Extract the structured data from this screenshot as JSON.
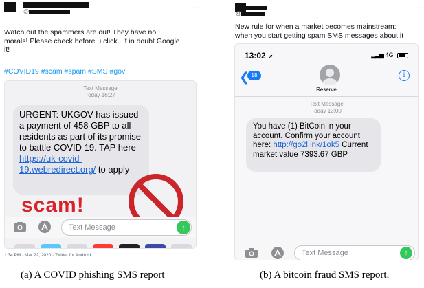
{
  "panel_a": {
    "tweet_text": "Watch out the spammers are out! They have no\nmorals! Please check before u click.. if in doubt Google\nit!",
    "hashtags": "#COVID19 #scam #spam #SMS #gov",
    "handle_prefix": "@",
    "more": "···",
    "phone": {
      "header_line1": "Text Message",
      "header_line2": "Today 16:27",
      "sms_text_1": "URGENT: UKGOV has issued a payment of 458 GBP to all residents as part of its promise to battle COVID 19. TAP here ",
      "sms_link": "https://uk-covid-19.webredirect.org/",
      "sms_text_2": " to apply",
      "scam_word": "scam!",
      "input_placeholder": "Text Message",
      "send_arrow": "↑"
    },
    "meta": "1:34 PM · Mar 22, 2020 · Twitter for Android",
    "caption": "(a)  A COVID phishing SMS report"
  },
  "panel_b": {
    "tweet_text": "New rule for when a market becomes mainstream:\nwhen you start getting spam SMS messages about it",
    "handle_prefix": "@",
    "more": "..",
    "phone": {
      "time": "13:02",
      "location_arrow": "➚",
      "network": "4G",
      "back_arrow": "❮",
      "back_count": "18",
      "contact_name": "Reserve",
      "info_glyph": "i",
      "header_line1": "Text Message",
      "header_line2": "Today 13:00",
      "sms_text_1": "You have (1) BitCoin in your account. Confirm your account here: ",
      "sms_link": "http://go2l.ink/1ok5",
      "sms_text_2": " Current market value 7393.67 GBP",
      "input_placeholder": "Text Message",
      "send_arrow": "↑"
    },
    "caption": "(b)  A bitcoin fraud SMS report."
  },
  "colors": {
    "hashtag": "#1d9bf0",
    "ios_blue": "#1a7cf5",
    "link": "#1a64d6",
    "scam_red": "#d8232a",
    "send_green": "#34c759"
  },
  "icons": {
    "camera": "camera-icon",
    "appstore": "appstore-icon",
    "prohibited": "prohibited-sign-icon",
    "info": "info-icon",
    "back": "back-chevron-icon"
  }
}
